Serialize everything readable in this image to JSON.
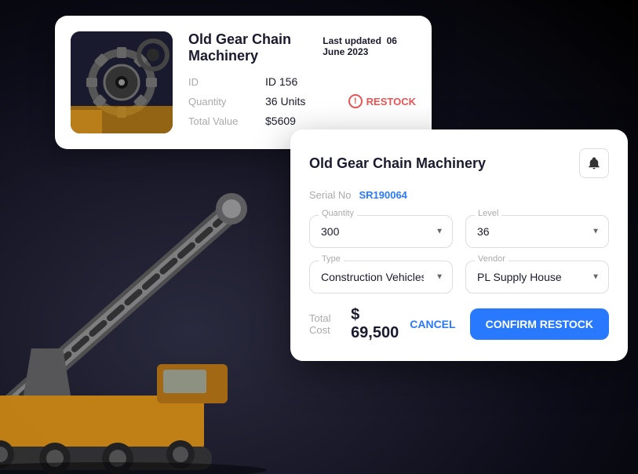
{
  "background": {
    "color": "#0d0d1a"
  },
  "card_main": {
    "title": "Old Gear Chain Machinery",
    "last_updated_label": "Last updated",
    "last_updated_date": "06 June 2023",
    "id_label": "ID",
    "id_value": "ID 156",
    "quantity_label": "Quantity",
    "quantity_value": "36 Units",
    "total_value_label": "Total Value",
    "total_value": "$5609",
    "restock_label": "RESTOCK"
  },
  "card_modal": {
    "title": "Old Gear Chain Machinery",
    "serial_label": "Serial No",
    "serial_value": "SR190064",
    "quantity_label": "Quantity",
    "quantity_value": "300",
    "level_label": "Level",
    "level_value": "36",
    "type_label": "Type",
    "type_value": "Construction Vehicles",
    "vendor_label": "Vendor",
    "vendor_value": "PL Supply House",
    "total_cost_label": "Total Cost",
    "total_cost_value": "$ 69,500",
    "cancel_label": "CANCEL",
    "confirm_label": "CONFIRM RESTOCK"
  }
}
